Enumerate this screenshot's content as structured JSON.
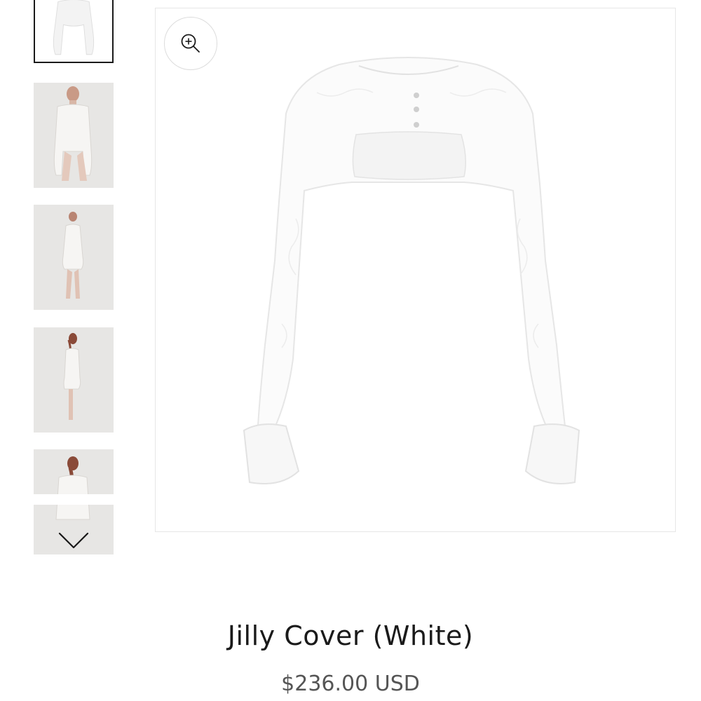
{
  "product": {
    "title": "Jilly Cover (White)",
    "price": "$236.00 USD"
  },
  "gallery": {
    "thumbnails": [
      {
        "label": "product-flat-front",
        "selected": true
      },
      {
        "label": "model-front-closeup",
        "selected": false
      },
      {
        "label": "model-full-front",
        "selected": false
      },
      {
        "label": "model-side",
        "selected": false
      },
      {
        "label": "model-back",
        "selected": false
      }
    ],
    "icons": {
      "zoom": "zoom-in-icon",
      "scroll_down": "chevron-down-icon"
    }
  },
  "colors": {
    "text": "#1a1a1a",
    "price": "#555555",
    "thumb_background": "#e7e6e4",
    "selected_border": "#1a1a1a"
  }
}
